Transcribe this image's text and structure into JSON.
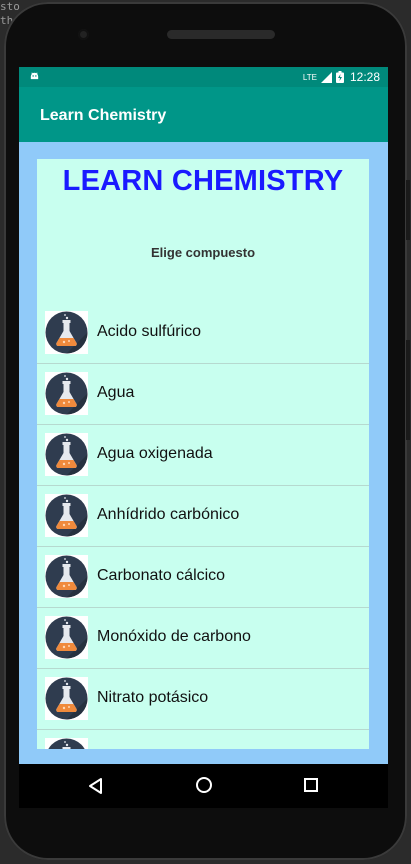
{
  "background_code": [
    "sto",
    "th"
  ],
  "status_bar": {
    "network": "LTE",
    "time": "12:28"
  },
  "app_bar": {
    "title": "Learn Chemistry"
  },
  "main": {
    "heading": "LEARN CHEMISTRY",
    "prompt": "Elige compuesto",
    "compounds": [
      {
        "name": "Acido sulfúrico",
        "icon": "flask-icon"
      },
      {
        "name": "Agua",
        "icon": "flask-icon"
      },
      {
        "name": "Agua oxigenada",
        "icon": "flask-icon"
      },
      {
        "name": "Anhídrido carbónico",
        "icon": "flask-icon"
      },
      {
        "name": "Carbonato cálcico",
        "icon": "flask-icon"
      },
      {
        "name": "Monóxido de carbono",
        "icon": "flask-icon"
      },
      {
        "name": "Nitrato potásico",
        "icon": "flask-icon"
      },
      {
        "name": "",
        "icon": "flask-icon"
      }
    ]
  },
  "colors": {
    "status_bar": "#00897B",
    "app_bar": "#009688",
    "heading": "#1a1aff",
    "content_bg": "#C8FFEF",
    "frame_bg": "#90CAF9"
  }
}
